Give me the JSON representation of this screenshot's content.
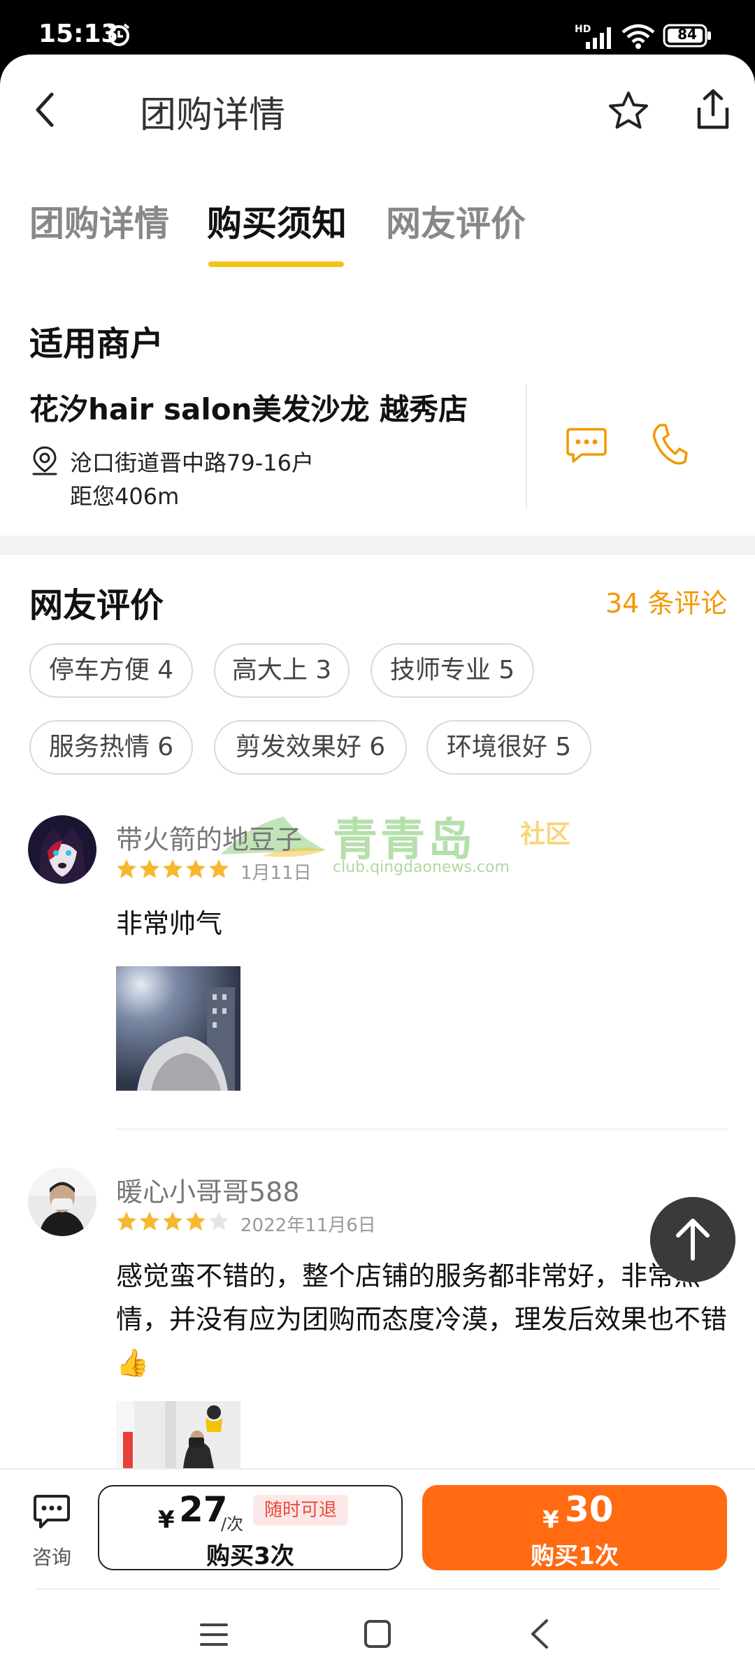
{
  "status_bar": {
    "time": "15:13",
    "network": "HD",
    "battery": "84"
  },
  "header": {
    "title": "团购详情",
    "back_icon": "chevron-left-icon",
    "favorite_icon": "star-icon",
    "share_icon": "share-icon"
  },
  "tabs": [
    {
      "label": "团购详情",
      "active": false
    },
    {
      "label": "购买须知",
      "active": true
    },
    {
      "label": "网友评价",
      "active": false
    }
  ],
  "merchant": {
    "heading": "适用商户",
    "name": "花汐hair salon美发沙龙 越秀店",
    "address": "沧口街道晋中路79-16户",
    "distance": "距您406m"
  },
  "reviews": {
    "heading": "网友评价",
    "count_label": "34 条评论",
    "tags": [
      "停车方便 4",
      "高大上 3",
      "技师专业 5",
      "服务热情 6",
      "剪发效果好 6",
      "环境很好 5"
    ],
    "items": [
      {
        "user": "带火箭的地豆子",
        "rating": 5,
        "date": "1月11日",
        "text": "非常帅气"
      },
      {
        "user": "暖心小哥哥588",
        "rating": 4,
        "date": "2022年11月6日",
        "text_line1": "感觉蛮不错的，整个店铺的服务都非常好，非常热",
        "text_line2": "情，并没有应为团购而态度冷漠，理发后效果也不错",
        "emoji": "👍"
      }
    ]
  },
  "watermark": {
    "main": "青青岛",
    "tag": "社区",
    "url": "club.qingdaonews.com"
  },
  "bottom_bar": {
    "consult_label": "咨询",
    "buy3": {
      "currency": "¥",
      "price": "27",
      "unit": "/次",
      "badge": "随时可退",
      "label": "购买3次"
    },
    "buy1": {
      "currency": "¥",
      "price": "30",
      "label": "购买1次"
    }
  },
  "colors": {
    "accent": "#F3C316",
    "orange": "#FF6A13",
    "count": "#F39800",
    "star": "#F5B82E"
  }
}
